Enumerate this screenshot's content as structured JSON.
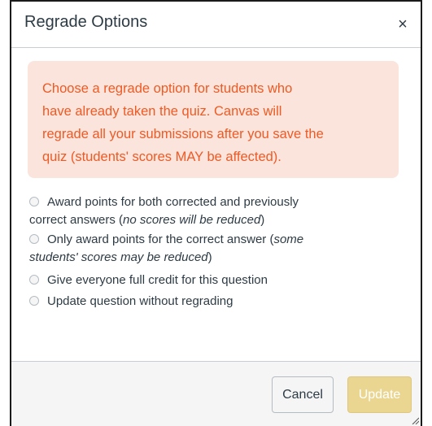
{
  "dialog": {
    "title": "Regrade Options",
    "close_glyph": "×"
  },
  "alert": {
    "message_lines": [
      "Choose a regrade option for students who",
      "have already taken the quiz. Canvas will",
      "regrade all your submissions after you save the",
      "quiz (students' scores MAY be affected)."
    ]
  },
  "options": [
    {
      "line1": "Award points for both corrected and previously",
      "line2_text": "correct answers (",
      "line2_note": "no scores will be reduced",
      "line2_end": ")"
    },
    {
      "line1_text": "Only award points for the correct answer (",
      "line1_note": "some",
      "line2_note": "students' scores may be reduced",
      "line2_end": ")"
    },
    {
      "label": "Give everyone full credit for this question"
    },
    {
      "label": "Update question without regrading"
    }
  ],
  "footer": {
    "cancel_label": "Cancel",
    "update_label": "Update"
  },
  "colors": {
    "alert_bg": "#fae4dc",
    "alert_text": "#ee5a24",
    "update_disabled": "#ead691"
  }
}
